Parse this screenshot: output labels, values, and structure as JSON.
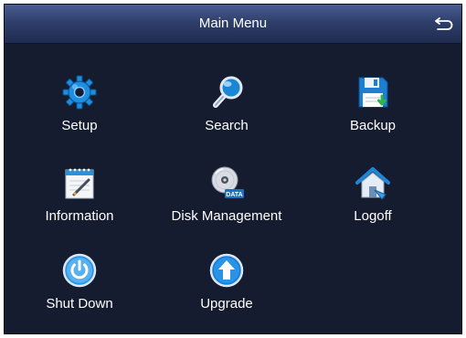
{
  "header": {
    "title": "Main Menu",
    "back_icon": "return-arrow-icon"
  },
  "menu": {
    "items": [
      {
        "label": "Setup",
        "icon": "gear-icon"
      },
      {
        "label": "Search",
        "icon": "magnifier-icon"
      },
      {
        "label": "Backup",
        "icon": "floppy-disk-icon"
      },
      {
        "label": "Information",
        "icon": "notepad-icon"
      },
      {
        "label": "Disk Management",
        "icon": "data-disc-icon"
      },
      {
        "label": "Logoff",
        "icon": "house-icon"
      },
      {
        "label": "Shut Down",
        "icon": "power-icon"
      },
      {
        "label": "Upgrade",
        "icon": "upload-arrow-icon"
      }
    ]
  },
  "colors": {
    "background": "#161c30",
    "titlebar": "#2f3f6c",
    "icon_blue": "#1c8fe0",
    "text": "#ffffff"
  }
}
